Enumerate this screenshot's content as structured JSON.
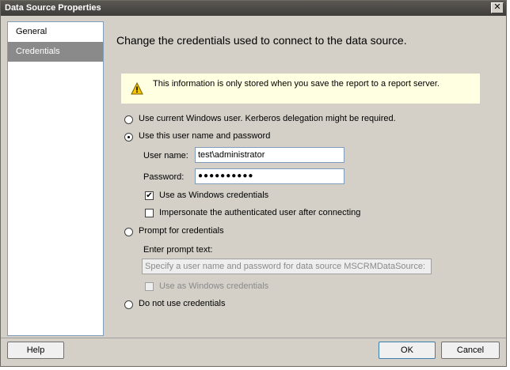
{
  "window": {
    "title": "Data Source Properties",
    "close_glyph": "✕"
  },
  "nav": {
    "items": [
      {
        "label": "General"
      },
      {
        "label": "Credentials"
      }
    ]
  },
  "content": {
    "heading": "Change the credentials used to connect to the data source.",
    "info_text": "This information is only stored when you save the report to a report server.",
    "options": {
      "windows_user": "Use current Windows user. Kerberos delegation might be required.",
      "user_password": "Use this user name and password",
      "prompt": "Prompt for credentials",
      "no_credentials": "Do not use credentials"
    },
    "selected_option": "user_password",
    "username_label": "User name:",
    "username_value": "test\\administrator",
    "password_label": "Password:",
    "password_value": "●●●●●●●●●●",
    "use_windows_credentials": {
      "label": "Use as Windows credentials",
      "checked": true
    },
    "impersonate": {
      "label": "Impersonate the authenticated user after connecting",
      "checked": false
    },
    "prompt_text_label": "Enter prompt text:",
    "prompt_text_value": "Specify a user name and password for data source MSCRMDataSource:",
    "prompt_windows_credentials": {
      "label": "Use as Windows credentials",
      "checked": false
    }
  },
  "footer": {
    "help": "Help",
    "ok": "OK",
    "cancel": "Cancel"
  },
  "colors": {
    "info_background": "#ffffe1",
    "nav_selected": "#8a8a8a",
    "titlebar": "#4a4844"
  },
  "icons": {
    "warning": "warning-icon",
    "close": "close-icon",
    "check": "checkmark-icon"
  }
}
